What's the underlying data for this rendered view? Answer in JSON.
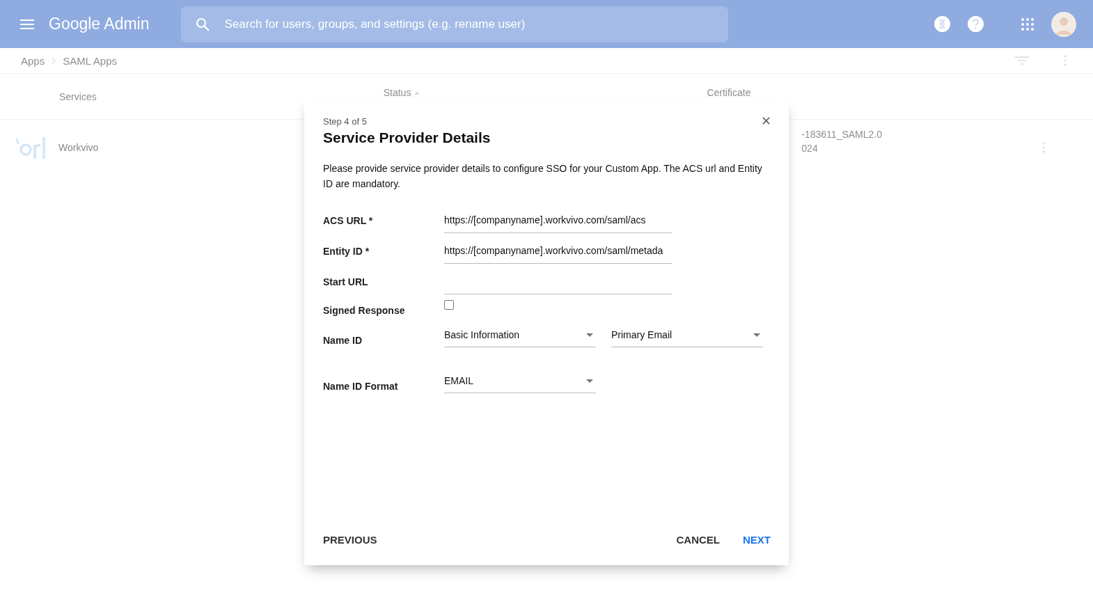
{
  "header": {
    "logo": "Google Admin",
    "search": {
      "placeholder": "Search for users, groups, and settings (e.g. rename user)"
    }
  },
  "breadcrumb": [
    "Apps",
    "SAML Apps"
  ],
  "table": {
    "columns": [
      "Services",
      "Status",
      "Certificate"
    ],
    "rows": [
      {
        "name": "Workvivo",
        "certificate": [
          "-183611_SAML2.0",
          "024"
        ]
      }
    ]
  },
  "dialog": {
    "step": "Step 4 of 5",
    "title": "Service Provider Details",
    "description": "Please provide service provider details to configure SSO for your Custom App. The ACS url and Entity ID are mandatory.",
    "fields": [
      {
        "kind": "text",
        "label": "ACS URL *",
        "value": "https://[companyname].workvivo.com/saml/acs"
      },
      {
        "kind": "text",
        "label": "Entity ID *",
        "value": "https://[companyname].workvivo.com/saml/metada"
      },
      {
        "kind": "text",
        "label": "Start URL"
      },
      {
        "kind": "checkbox",
        "label": "Signed Response",
        "checked": false
      },
      {
        "kind": "select",
        "label": "Name ID",
        "values": [
          "Basic Information",
          "Primary Email"
        ]
      },
      {
        "kind": "select",
        "label": "Name ID Format",
        "values": [
          "EMAIL"
        ]
      }
    ],
    "buttons": {
      "previous": "PREVIOUS",
      "cancel": "CANCEL",
      "next": "NEXT"
    }
  }
}
